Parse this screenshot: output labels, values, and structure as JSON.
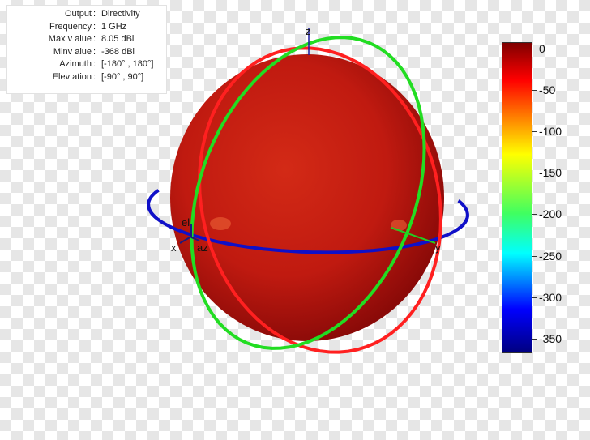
{
  "info": {
    "rows": [
      {
        "key": "Output",
        "value": "Directivity"
      },
      {
        "key": "Frequency",
        "value": "1 GHz"
      },
      {
        "key": "Max v alue",
        "value": "8.05 dBi"
      },
      {
        "key": "Minv alue",
        "value": "-368 dBi"
      },
      {
        "key": "Azimuth",
        "value": "[-180° , 180°]"
      },
      {
        "key": "Elev ation",
        "value": "[-90° , 90°]"
      }
    ],
    "separator": ":"
  },
  "chart_data": {
    "type": "heatmap",
    "title": "",
    "quantity": "Directivity",
    "unit": "dBi",
    "frequency": "1 GHz",
    "max_value": 8.05,
    "min_value": -368,
    "azimuth_range": [
      -180,
      180
    ],
    "elevation_range": [
      -90,
      90
    ],
    "axes_labels": {
      "x": "x",
      "y": "y",
      "z": "z",
      "el": "el",
      "az": "az"
    },
    "colorbar": {
      "range": [
        -368,
        8.05
      ],
      "ticks": [
        0,
        -50,
        -100,
        -150,
        -200,
        -250,
        -300,
        -350
      ],
      "colormap": "jet"
    },
    "pattern_shape": "sphere",
    "pattern_color": "#cc1a10",
    "cut_planes": [
      {
        "name": "azimuth",
        "color": "#1010c8"
      },
      {
        "name": "elevation-xz",
        "color": "#ff2020"
      },
      {
        "name": "elevation-yz",
        "color": "#22dd22"
      }
    ]
  }
}
